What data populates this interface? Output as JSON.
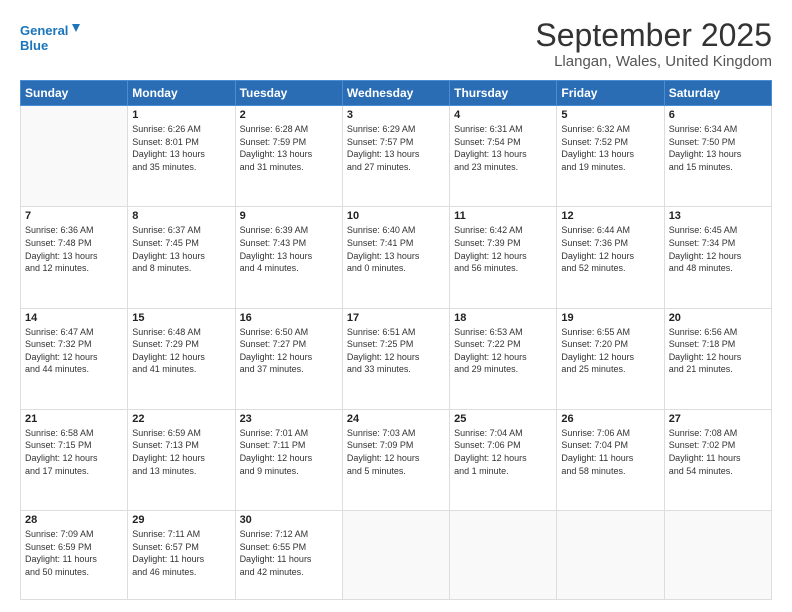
{
  "logo": {
    "line1": "General",
    "line2": "Blue"
  },
  "title": "September 2025",
  "subtitle": "Llangan, Wales, United Kingdom",
  "days_of_week": [
    "Sunday",
    "Monday",
    "Tuesday",
    "Wednesday",
    "Thursday",
    "Friday",
    "Saturday"
  ],
  "weeks": [
    [
      {
        "day": "",
        "info": ""
      },
      {
        "day": "1",
        "info": "Sunrise: 6:26 AM\nSunset: 8:01 PM\nDaylight: 13 hours\nand 35 minutes."
      },
      {
        "day": "2",
        "info": "Sunrise: 6:28 AM\nSunset: 7:59 PM\nDaylight: 13 hours\nand 31 minutes."
      },
      {
        "day": "3",
        "info": "Sunrise: 6:29 AM\nSunset: 7:57 PM\nDaylight: 13 hours\nand 27 minutes."
      },
      {
        "day": "4",
        "info": "Sunrise: 6:31 AM\nSunset: 7:54 PM\nDaylight: 13 hours\nand 23 minutes."
      },
      {
        "day": "5",
        "info": "Sunrise: 6:32 AM\nSunset: 7:52 PM\nDaylight: 13 hours\nand 19 minutes."
      },
      {
        "day": "6",
        "info": "Sunrise: 6:34 AM\nSunset: 7:50 PM\nDaylight: 13 hours\nand 15 minutes."
      }
    ],
    [
      {
        "day": "7",
        "info": "Sunrise: 6:36 AM\nSunset: 7:48 PM\nDaylight: 13 hours\nand 12 minutes."
      },
      {
        "day": "8",
        "info": "Sunrise: 6:37 AM\nSunset: 7:45 PM\nDaylight: 13 hours\nand 8 minutes."
      },
      {
        "day": "9",
        "info": "Sunrise: 6:39 AM\nSunset: 7:43 PM\nDaylight: 13 hours\nand 4 minutes."
      },
      {
        "day": "10",
        "info": "Sunrise: 6:40 AM\nSunset: 7:41 PM\nDaylight: 13 hours\nand 0 minutes."
      },
      {
        "day": "11",
        "info": "Sunrise: 6:42 AM\nSunset: 7:39 PM\nDaylight: 12 hours\nand 56 minutes."
      },
      {
        "day": "12",
        "info": "Sunrise: 6:44 AM\nSunset: 7:36 PM\nDaylight: 12 hours\nand 52 minutes."
      },
      {
        "day": "13",
        "info": "Sunrise: 6:45 AM\nSunset: 7:34 PM\nDaylight: 12 hours\nand 48 minutes."
      }
    ],
    [
      {
        "day": "14",
        "info": "Sunrise: 6:47 AM\nSunset: 7:32 PM\nDaylight: 12 hours\nand 44 minutes."
      },
      {
        "day": "15",
        "info": "Sunrise: 6:48 AM\nSunset: 7:29 PM\nDaylight: 12 hours\nand 41 minutes."
      },
      {
        "day": "16",
        "info": "Sunrise: 6:50 AM\nSunset: 7:27 PM\nDaylight: 12 hours\nand 37 minutes."
      },
      {
        "day": "17",
        "info": "Sunrise: 6:51 AM\nSunset: 7:25 PM\nDaylight: 12 hours\nand 33 minutes."
      },
      {
        "day": "18",
        "info": "Sunrise: 6:53 AM\nSunset: 7:22 PM\nDaylight: 12 hours\nand 29 minutes."
      },
      {
        "day": "19",
        "info": "Sunrise: 6:55 AM\nSunset: 7:20 PM\nDaylight: 12 hours\nand 25 minutes."
      },
      {
        "day": "20",
        "info": "Sunrise: 6:56 AM\nSunset: 7:18 PM\nDaylight: 12 hours\nand 21 minutes."
      }
    ],
    [
      {
        "day": "21",
        "info": "Sunrise: 6:58 AM\nSunset: 7:15 PM\nDaylight: 12 hours\nand 17 minutes."
      },
      {
        "day": "22",
        "info": "Sunrise: 6:59 AM\nSunset: 7:13 PM\nDaylight: 12 hours\nand 13 minutes."
      },
      {
        "day": "23",
        "info": "Sunrise: 7:01 AM\nSunset: 7:11 PM\nDaylight: 12 hours\nand 9 minutes."
      },
      {
        "day": "24",
        "info": "Sunrise: 7:03 AM\nSunset: 7:09 PM\nDaylight: 12 hours\nand 5 minutes."
      },
      {
        "day": "25",
        "info": "Sunrise: 7:04 AM\nSunset: 7:06 PM\nDaylight: 12 hours\nand 1 minute."
      },
      {
        "day": "26",
        "info": "Sunrise: 7:06 AM\nSunset: 7:04 PM\nDaylight: 11 hours\nand 58 minutes."
      },
      {
        "day": "27",
        "info": "Sunrise: 7:08 AM\nSunset: 7:02 PM\nDaylight: 11 hours\nand 54 minutes."
      }
    ],
    [
      {
        "day": "28",
        "info": "Sunrise: 7:09 AM\nSunset: 6:59 PM\nDaylight: 11 hours\nand 50 minutes."
      },
      {
        "day": "29",
        "info": "Sunrise: 7:11 AM\nSunset: 6:57 PM\nDaylight: 11 hours\nand 46 minutes."
      },
      {
        "day": "30",
        "info": "Sunrise: 7:12 AM\nSunset: 6:55 PM\nDaylight: 11 hours\nand 42 minutes."
      },
      {
        "day": "",
        "info": ""
      },
      {
        "day": "",
        "info": ""
      },
      {
        "day": "",
        "info": ""
      },
      {
        "day": "",
        "info": ""
      }
    ]
  ]
}
